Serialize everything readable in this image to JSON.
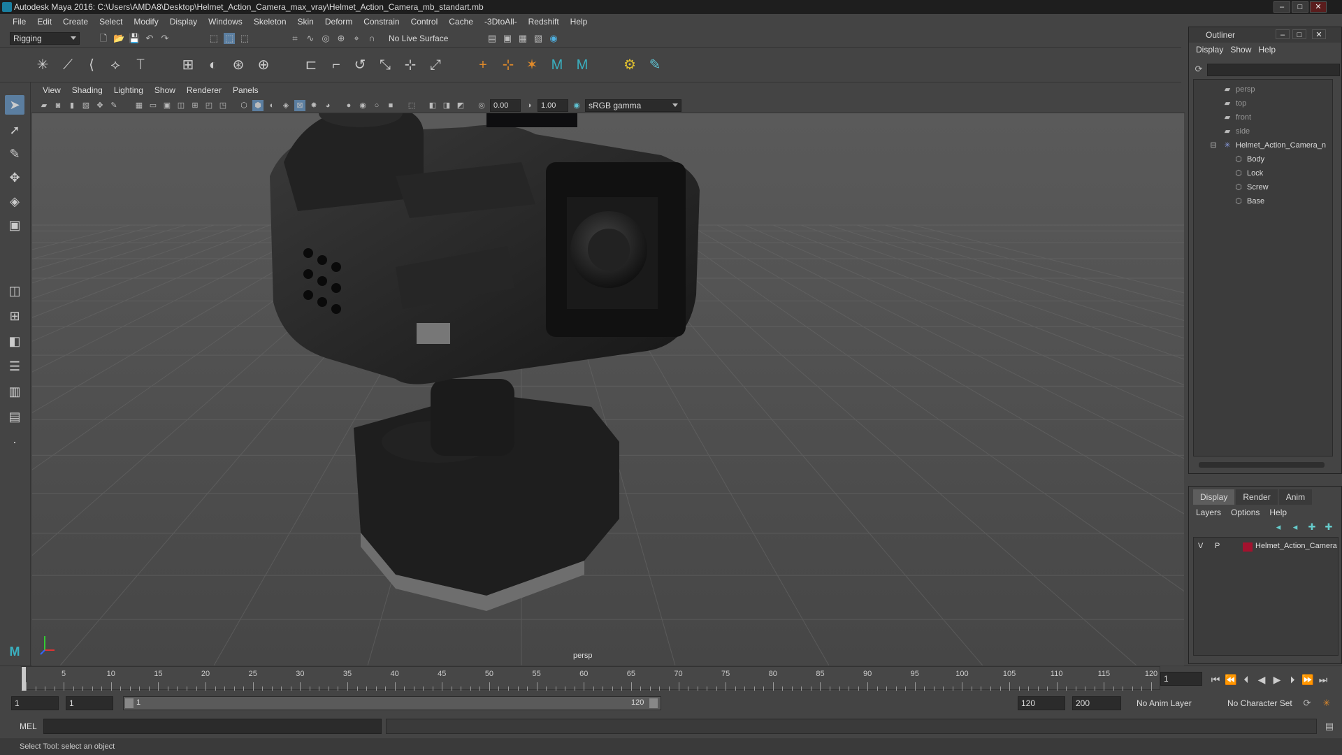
{
  "window": {
    "title": "Autodesk Maya 2016: C:\\Users\\AMDA8\\Desktop\\Helmet_Action_Camera_max_vray\\Helmet_Action_Camera_mb_standart.mb"
  },
  "menu": [
    "File",
    "Edit",
    "Create",
    "Select",
    "Modify",
    "Display",
    "Windows",
    "Skeleton",
    "Skin",
    "Deform",
    "Constrain",
    "Control",
    "Cache",
    "-3DtoAll-",
    "Redshift",
    "Help"
  ],
  "statusline": {
    "menuset": "Rigging",
    "live_surface": "No Live Surface"
  },
  "viewport": {
    "menu": [
      "View",
      "Shading",
      "Lighting",
      "Show",
      "Renderer",
      "Panels"
    ],
    "exposure": "0.00",
    "gamma": "1.00",
    "color_space": "sRGB gamma",
    "camera_label": "persp"
  },
  "outliner": {
    "title": "Outliner",
    "menu": [
      "Display",
      "Show",
      "Help"
    ],
    "cameras": [
      "persp",
      "top",
      "front",
      "side"
    ],
    "group": "Helmet_Action_Camera_n",
    "children": [
      "Body",
      "Lock",
      "Screw",
      "Base"
    ]
  },
  "layers": {
    "tabs": [
      "Display",
      "Render",
      "Anim"
    ],
    "menu": [
      "Layers",
      "Options",
      "Help"
    ],
    "row": {
      "v": "V",
      "p": "P",
      "name": "Helmet_Action_Camera",
      "color": "#a3122e"
    }
  },
  "timeline": {
    "ticks": [
      "1",
      "5",
      "10",
      "15",
      "20",
      "25",
      "30",
      "35",
      "40",
      "45",
      "50",
      "55",
      "60",
      "65",
      "70",
      "75",
      "80",
      "85",
      "90",
      "95",
      "100",
      "105",
      "110",
      "115",
      "120"
    ],
    "current_frame": "1"
  },
  "range": {
    "start": "1",
    "playback_start": "1",
    "slider_start": "1",
    "slider_end": "120",
    "playback_end": "120",
    "end": "200",
    "anim_layer": "No Anim Layer",
    "character_set": "No Character Set"
  },
  "command": {
    "label": "MEL"
  },
  "help": {
    "text": "Select Tool: select an object"
  }
}
